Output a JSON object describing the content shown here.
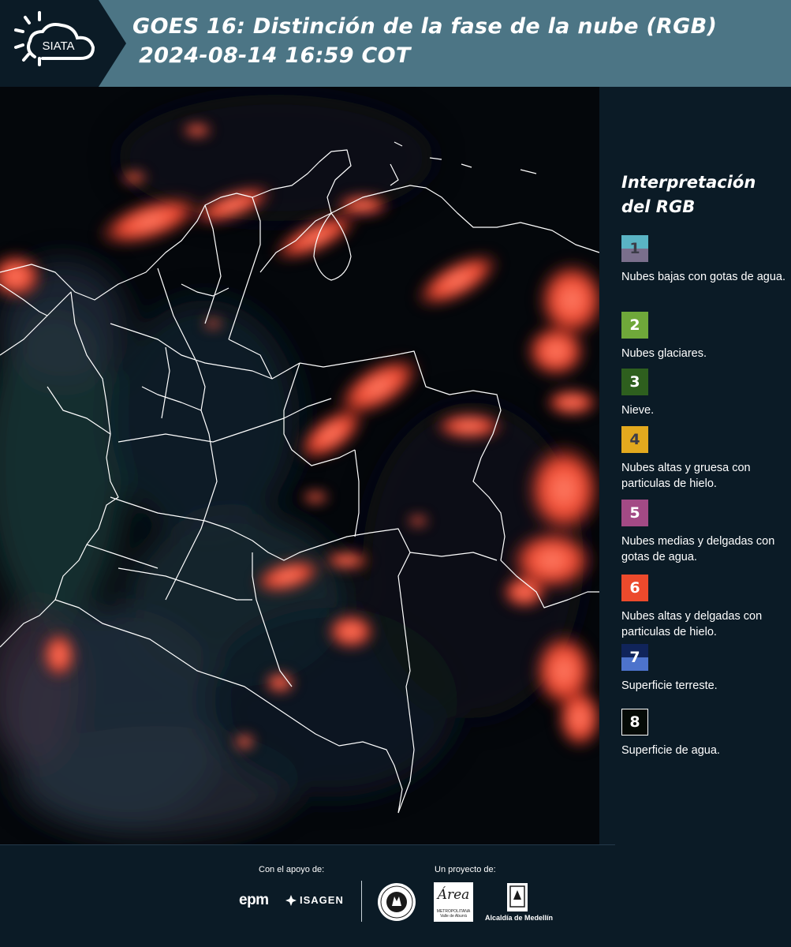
{
  "header": {
    "logo_text": "SIATA",
    "title_line1": "GOES 16: Distinción de la fase de la nube (RGB)",
    "title_line2": "2024-08-14 16:59 COT",
    "band_color": "#4c7585"
  },
  "map": {
    "product": "Distinción de la fase de la nube (RGB)",
    "satellite": "GOES 16"
  },
  "legend": {
    "title_line1": "Interpretación",
    "title_line2": "del RGB",
    "items": [
      {
        "number": "1",
        "label": "Nubes bajas con gotas de agua.",
        "color_top": "#5ab4c4",
        "color_bottom": "#7a6f8c",
        "text_color": "#3c3c48"
      },
      {
        "number": "2",
        "label": "Nubes glaciares.",
        "color_top": "#6fa83a",
        "color_bottom": "#6fa83a",
        "text_color": "#ffffff"
      },
      {
        "number": "3",
        "label": "Nieve.",
        "color_top": "#2e5f1e",
        "color_bottom": "#2e5f1e",
        "text_color": "#ffffff"
      },
      {
        "number": "4",
        "label": "Nubes altas y gruesa con particulas de hielo.",
        "color_top": "#e3a91e",
        "color_bottom": "#e3a91e",
        "text_color": "#3c3c48"
      },
      {
        "number": "5",
        "label": "Nubes medias y delgadas con gotas de agua.",
        "color_top": "#a34a85",
        "color_bottom": "#a34a85",
        "text_color": "#ffffff"
      },
      {
        "number": "6",
        "label": "Nubes altas y delgadas con particulas de hielo.",
        "color_top": "#ec4a2c",
        "color_bottom": "#ec4a2c",
        "text_color": "#ffffff"
      },
      {
        "number": "7",
        "label": "Superficie terreste.",
        "color_top": "#10245a",
        "color_bottom": "#4d73cc",
        "text_color": "#ffffff"
      },
      {
        "number": "8",
        "label": "Superficie de agua.",
        "color_top": "#050a06",
        "color_bottom": "#050a06",
        "text_color": "#ffffff"
      }
    ]
  },
  "footer": {
    "support_label": "Con el apoyo de:",
    "project_label": "Un proyecto de:",
    "epm_text": "epm",
    "isagen_text": "ISAGEN",
    "area_text": "Área",
    "area_sub": "METROPOLITANA Valle de Aburrá",
    "alcaldia_text": "Alcaldía de Medellín"
  }
}
